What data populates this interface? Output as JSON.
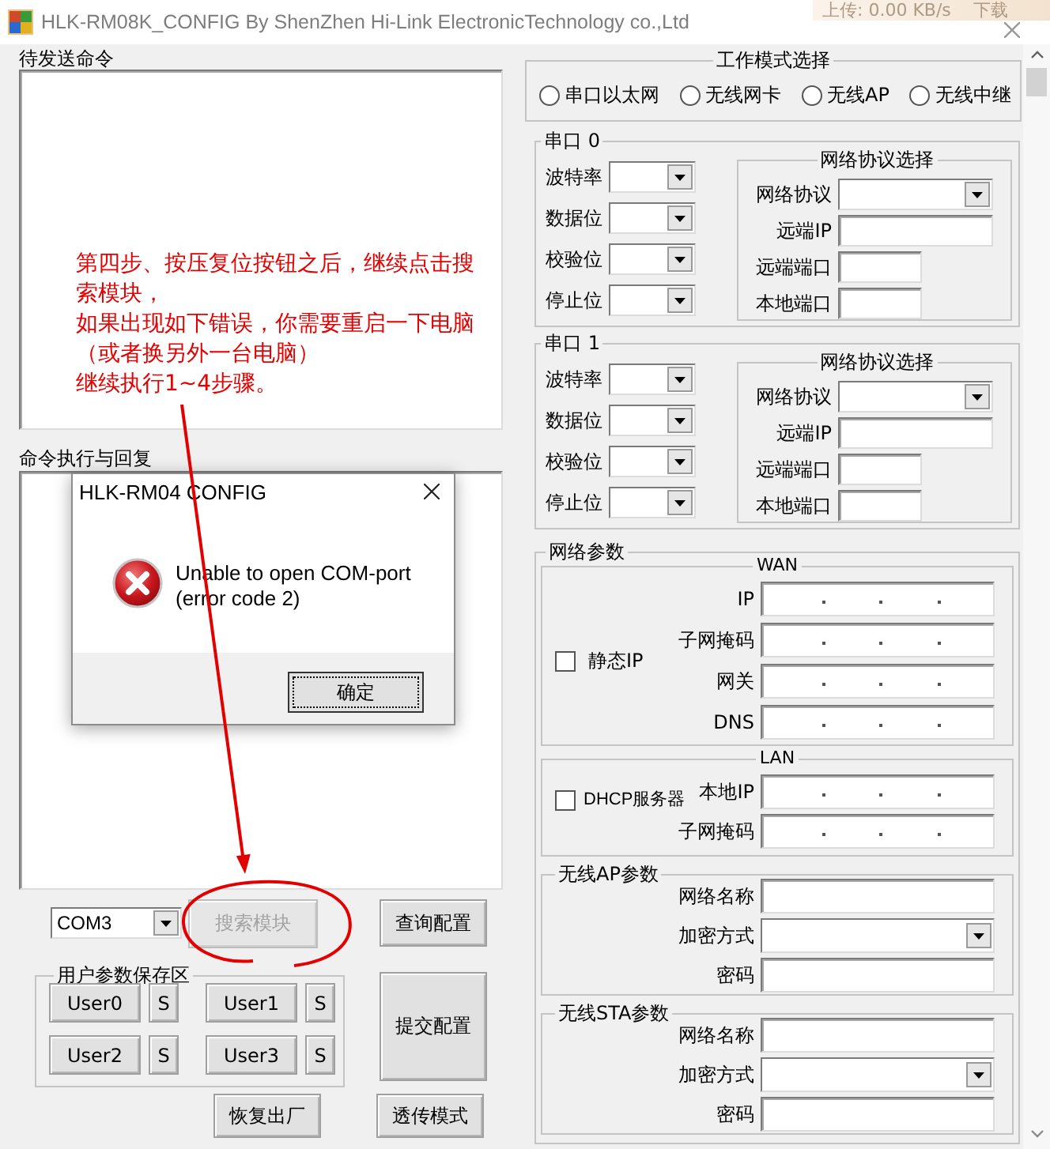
{
  "window": {
    "title": "HLK-RM08K_CONFIG By ShenZhen Hi-Link ElectronicTechnology co.,Ltd"
  },
  "speed_overlay": {
    "upload": "上传: 0.00 KB/s",
    "download": "下载"
  },
  "send_panel": {
    "label": "待发送命令"
  },
  "reply_panel": {
    "label": "命令执行与回复"
  },
  "port_select": {
    "value": "COM3"
  },
  "action_buttons": [
    {
      "label": "搜索模块",
      "disabled": true
    },
    {
      "label": "查询配置",
      "disabled": false
    },
    {
      "label": "提交配置",
      "disabled": false
    },
    {
      "label": "恢复出厂",
      "disabled": false
    },
    {
      "label": "透传模式",
      "disabled": false
    }
  ],
  "user_params": {
    "title": "用户参数保存区",
    "slots": [
      {
        "label": "User0",
        "save": "S"
      },
      {
        "label": "User1",
        "save": "S"
      },
      {
        "label": "User2",
        "save": "S"
      },
      {
        "label": "User3",
        "save": "S"
      }
    ]
  },
  "work_mode": {
    "title": "工作模式选择",
    "options": [
      {
        "label": "串口以太网",
        "selected": false
      },
      {
        "label": "无线网卡",
        "selected": false
      },
      {
        "label": "无线AP",
        "selected": false
      },
      {
        "label": "无线中继",
        "selected": false
      }
    ]
  },
  "serial_ports": [
    {
      "title": "串口 0",
      "fields": [
        "波特率",
        "数据位",
        "校验位",
        "停止位"
      ],
      "network": {
        "title": "网络协议选择",
        "fields": [
          {
            "label": "网络协议",
            "kind": "dropdown"
          },
          {
            "label": "远端IP",
            "kind": "text"
          },
          {
            "label": "远端端口",
            "kind": "port"
          },
          {
            "label": "本地端口",
            "kind": "port"
          }
        ]
      }
    },
    {
      "title": "串口 1",
      "fields": [
        "波特率",
        "数据位",
        "校验位",
        "停止位"
      ],
      "network": {
        "title": "网络协议选择",
        "fields": [
          {
            "label": "网络协议",
            "kind": "dropdown"
          },
          {
            "label": "远端IP",
            "kind": "text"
          },
          {
            "label": "远端端口",
            "kind": "port"
          },
          {
            "label": "本地端口",
            "kind": "port"
          }
        ]
      }
    }
  ],
  "network_params": {
    "title": "网络参数",
    "wan": {
      "title": "WAN",
      "checkbox": {
        "label": "静态IP",
        "checked": false
      },
      "fields": [
        "IP",
        "子网掩码",
        "网关",
        "DNS"
      ]
    },
    "lan": {
      "title": "LAN",
      "checkbox": {
        "label": "DHCP服务器",
        "checked": false
      },
      "fields": [
        "本地IP",
        "子网掩码"
      ]
    },
    "wireless": [
      {
        "title": "无线AP参数",
        "fields": [
          {
            "label": "网络名称",
            "kind": "text"
          },
          {
            "label": "加密方式",
            "kind": "dropdown"
          },
          {
            "label": "密码",
            "kind": "text"
          }
        ]
      },
      {
        "title": "无线STA参数",
        "fields": [
          {
            "label": "网络名称",
            "kind": "text"
          },
          {
            "label": "加密方式",
            "kind": "dropdown"
          },
          {
            "label": "密码",
            "kind": "text"
          }
        ]
      }
    ]
  },
  "dialog": {
    "title": "HLK-RM04 CONFIG",
    "message": [
      "Unable to open COM-port",
      "(error code 2)"
    ],
    "button": "确定"
  },
  "annotation": {
    "lines": [
      "第四步、按压复位按钮之后，继续点击搜索模块，",
      "如果出现如下错误，你需要重启一下电脑（或者换另外一台电脑）",
      "继续执行1~4步骤。"
    ]
  }
}
